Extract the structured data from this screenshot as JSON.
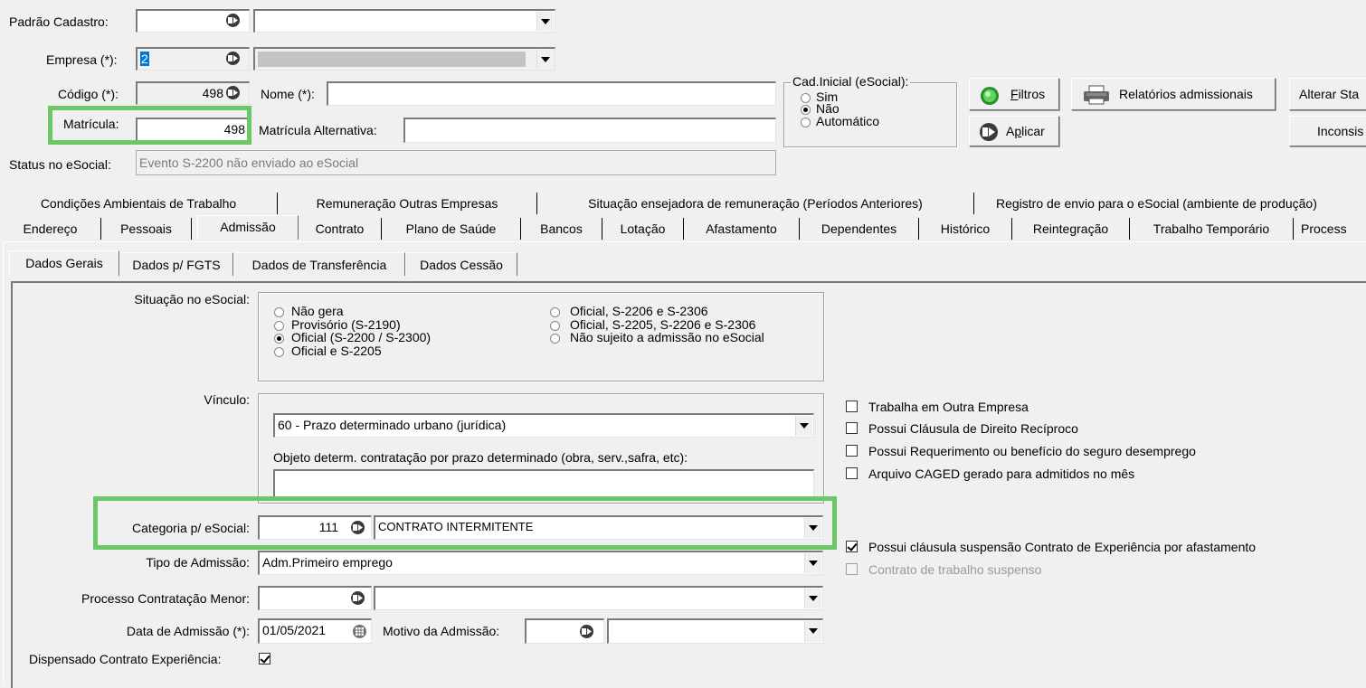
{
  "header": {
    "padrao_cadastro": {
      "label": "Padrão Cadastro:",
      "code": "",
      "select": ""
    },
    "empresa": {
      "label": "Empresa (*):",
      "code": "2",
      "name": ""
    },
    "codigo": {
      "label": "Código (*):",
      "value": "498"
    },
    "nome": {
      "label": "Nome (*):",
      "value": ""
    },
    "matricula": {
      "label": "Matrícula:",
      "value": "498"
    },
    "matricula_alt": {
      "label": "Matrícula Alternativa:",
      "value": ""
    },
    "status_esocial": {
      "label": "Status no eSocial:",
      "value": "Evento S-2200 não enviado ao eSocial"
    },
    "cad_inicial": {
      "title": "Cad.Inicial (eSocial):",
      "options": [
        "Sim",
        "Não",
        "Automático"
      ],
      "selected": "Não"
    },
    "buttons": {
      "filtros_u": "F",
      "filtros_rest": "iltros",
      "aplicar_pre": "A",
      "aplicar_u": "p",
      "aplicar_rest": "licar",
      "relatorios": "Relatórios admissionais",
      "alterar": "Alterar Sta",
      "inconsis": "Inconsis"
    }
  },
  "tabs_row1": [
    "Condições Ambientais de Trabalho",
    "Remuneração Outras Empresas",
    "Situação ensejadora de remuneração (Períodos Anteriores)",
    "Registro de envio para o eSocial (ambiente de produção)"
  ],
  "tabs_row2": [
    "Endereço",
    "Pessoais",
    "Admissão",
    "Contrato",
    "Plano de Saúde",
    "Bancos",
    "Lotação",
    "Afastamento",
    "Dependentes",
    "Histórico",
    "Reintegração",
    "Trabalho Temporário",
    "Process"
  ],
  "active_tab": "Admissão",
  "subtabs": [
    "Dados Gerais",
    "Dados p/ FGTS",
    "Dados de Transferência",
    "Dados Cessão"
  ],
  "active_subtab": "Dados Gerais",
  "form": {
    "situacao": {
      "label": "Situação no eSocial:",
      "options": [
        "Não gera",
        "Provisório (S-2190)",
        "Oficial (S-2200 / S-2300)",
        "Oficial e S-2205",
        "Oficial, S-2206 e S-2306",
        "Oficial, S-2205, S-2206 e S-2306",
        "Não sujeito a admissão no eSocial"
      ],
      "selected": "Oficial (S-2200 / S-2300)"
    },
    "vinculo": {
      "label": "Vínculo:",
      "value": "60 - Prazo determinado urbano (jurídica)",
      "objeto_label": "Objeto determ. contratação por prazo determinado (obra, serv.,safra, etc):",
      "objeto_value": ""
    },
    "categoria": {
      "label": "Categoria p/ eSocial:",
      "code": "111",
      "value": "CONTRATO INTERMITENTE"
    },
    "tipo_admissao": {
      "label": "Tipo de Admissão:",
      "value": "Adm.Primeiro emprego"
    },
    "processo_menor": {
      "label": "Processo Contratação Menor:",
      "code": "",
      "value": ""
    },
    "data_admissao": {
      "label": "Data de Admissão (*):",
      "value": "01/05/2021"
    },
    "motivo": {
      "label": "Motivo da Admissão:",
      "code": "",
      "value": ""
    },
    "dispensado": {
      "label": "Dispensado Contrato Experiência:",
      "checked": true
    },
    "checkboxes": [
      {
        "label": "Trabalha em Outra Empresa",
        "checked": false,
        "enabled": true
      },
      {
        "label": "Possui Cláusula de Direito Recíproco",
        "checked": false,
        "enabled": true
      },
      {
        "label": "Possui Requerimento ou benefício do seguro desemprego",
        "checked": false,
        "enabled": true
      },
      {
        "label": "Arquivo CAGED gerado para admitidos no mês",
        "checked": false,
        "enabled": true
      },
      {
        "label": "Possui cláusula suspensão Contrato de Experiência por afastamento",
        "checked": true,
        "enabled": true
      },
      {
        "label": "Contrato de trabalho suspenso",
        "checked": false,
        "enabled": false
      }
    ]
  },
  "colors": {
    "highlight": "#6cc865",
    "window_bg": "#f0f0f0"
  }
}
